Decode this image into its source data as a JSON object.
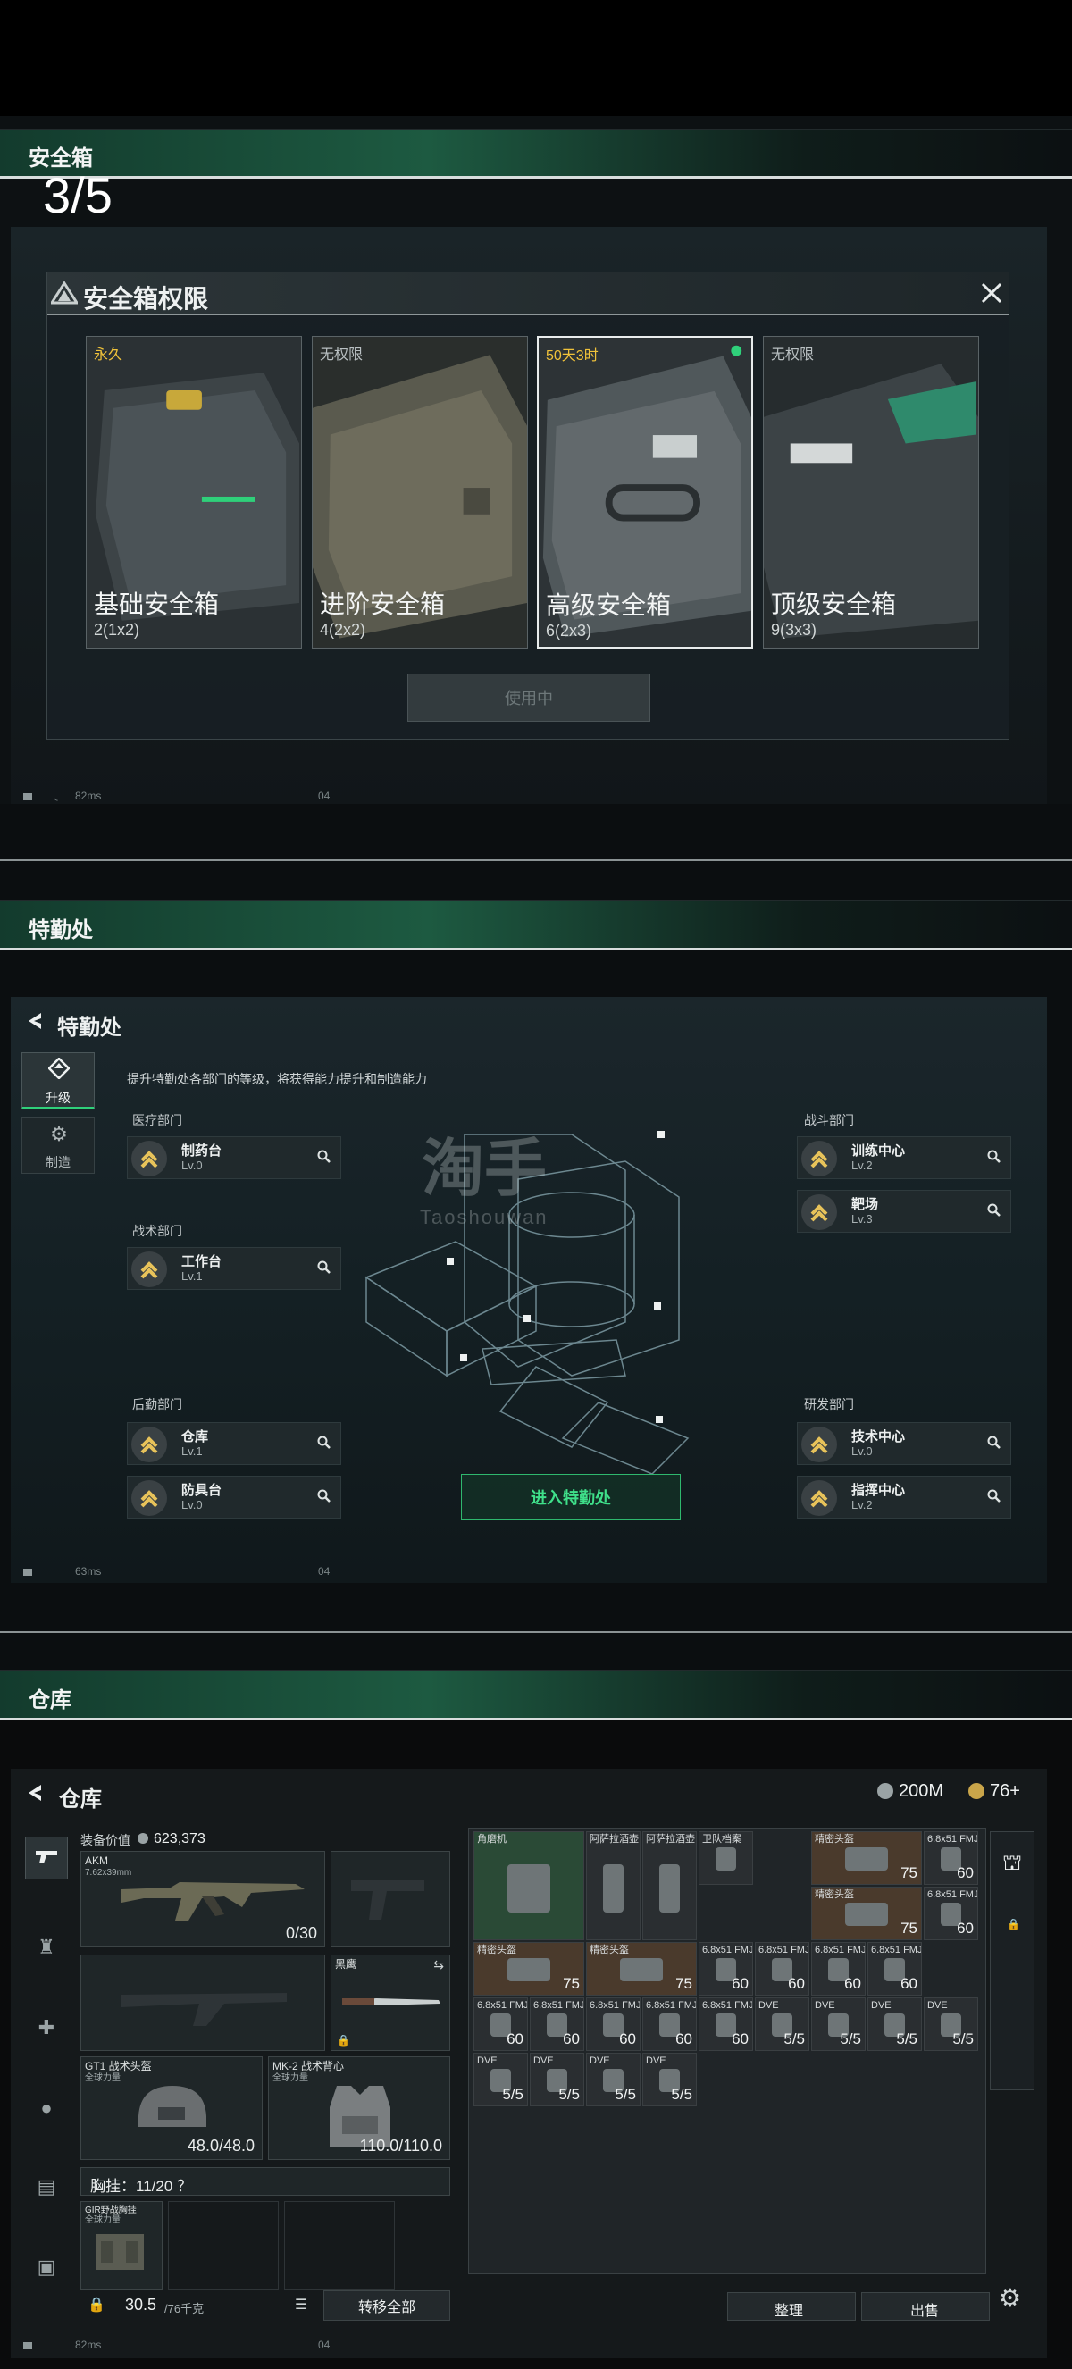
{
  "sections": {
    "safebox": "安全箱",
    "ops": "特勤处",
    "warehouse": "仓库"
  },
  "safebox": {
    "page_counter": "3/5",
    "dialog_title": "安全箱权限",
    "cards": [
      {
        "tag": "永久",
        "tag_color": "#f0c23a",
        "name": "基础安全箱",
        "capacity": "2(1x2)"
      },
      {
        "tag": "无权限",
        "tag_color": "#b9c0c2",
        "name": "进阶安全箱",
        "capacity": "4(2x2)"
      },
      {
        "tag": "50天3时",
        "tag_color": "#f0c23a",
        "name": "高级安全箱",
        "capacity": "6(2x3)"
      },
      {
        "tag": "无权限",
        "tag_color": "#b9c0c2",
        "name": "顶级安全箱",
        "capacity": "9(3x3)"
      }
    ],
    "use_button": "使用中",
    "status_ping": "82ms",
    "status_code": "04"
  },
  "ops": {
    "back_title": "特勤处",
    "tab_upgrade": "升级",
    "tab_craft": "制造",
    "description": "提升特勤处各部门的等级，将获得能力提升和制造能力",
    "watermark_cn": "淘手",
    "watermark_en": "Taoshouwan",
    "departments": {
      "medical": {
        "title": "医疗部门",
        "items": [
          {
            "name": "制药台",
            "level": "Lv.0"
          }
        ]
      },
      "tactical": {
        "title": "战术部门",
        "items": [
          {
            "name": "工作台",
            "level": "Lv.1"
          }
        ]
      },
      "logistics": {
        "title": "后勤部门",
        "items": [
          {
            "name": "仓库",
            "level": "Lv.1"
          },
          {
            "name": "防具台",
            "level": "Lv.0"
          }
        ]
      },
      "combat": {
        "title": "战斗部门",
        "items": [
          {
            "name": "训练中心",
            "level": "Lv.2"
          },
          {
            "name": "靶场",
            "level": "Lv.3"
          }
        ]
      },
      "research": {
        "title": "研发部门",
        "items": [
          {
            "name": "技术中心",
            "level": "Lv.0"
          },
          {
            "name": "指挥中心",
            "level": "Lv.2"
          }
        ]
      }
    },
    "enter_button": "进入特勤处",
    "status_ping": "63ms",
    "status_code": "04"
  },
  "warehouse": {
    "back_title": "仓库",
    "currency_1": "200M",
    "currency_2": "76+",
    "equip_value_label": "装备价值",
    "equip_value": "623,373",
    "primary_weapon": {
      "name": "AKM",
      "caliber": "7.62x39mm",
      "ammo": "0/30"
    },
    "melee_name": "黑鹰",
    "helmet": {
      "name": "GT1 战术头盔",
      "sub": "全球力量",
      "durability": "48.0/48.0"
    },
    "armor": {
      "name": "MK-2 战术背心",
      "sub": "全球力量",
      "durability": "110.0/110.0"
    },
    "chest_rig_label": "胸挂：11/20 ？",
    "chest_rig_item": "GIR野战胸挂",
    "chest_rig_sub": "全球力量",
    "weight": "30.5",
    "weight_max": "/76千克",
    "transfer_all": "转移全部",
    "sort_button": "整理",
    "sell_button": "出售",
    "status_ping": "82ms",
    "status_code": "04",
    "items": [
      {
        "name": "角磨机",
        "count": ""
      },
      {
        "name": "阿萨拉酒壶",
        "count": ""
      },
      {
        "name": "阿萨拉酒壶",
        "count": ""
      },
      {
        "name": "卫队档案",
        "count": ""
      },
      {
        "name": "精密头盔",
        "count": "75"
      },
      {
        "name": "精密头盔",
        "count": "75"
      },
      {
        "name": "精密头盔",
        "count": "75"
      },
      {
        "name": "精密头盔",
        "count": "75"
      },
      {
        "name": "6.8x51 FMJ",
        "count": "60"
      },
      {
        "name": "6.8x51 FMJ",
        "count": "60"
      },
      {
        "name": "6.8x51 FMJ",
        "count": "60"
      },
      {
        "name": "6.8x51 FMJ",
        "count": "60"
      },
      {
        "name": "6.8x51 FMJ",
        "count": "60"
      },
      {
        "name": "6.8x51 FMJ",
        "count": "60"
      },
      {
        "name": "6.8x51 FMJ",
        "count": "60"
      },
      {
        "name": "6.8x51 FMJ",
        "count": "60"
      },
      {
        "name": "6.8x51 FMJ",
        "count": "60"
      },
      {
        "name": "6.8x51 FMJ",
        "count": "60"
      },
      {
        "name": "6.8x51 FMJ",
        "count": "60"
      },
      {
        "name": "DVE",
        "count": "5/5"
      },
      {
        "name": "DVE",
        "count": "5/5"
      },
      {
        "name": "DVE",
        "count": "5/5"
      },
      {
        "name": "DVE",
        "count": "5/5"
      },
      {
        "name": "DVE",
        "count": "5/5"
      },
      {
        "name": "DVE",
        "count": "5/5"
      },
      {
        "name": "DVE",
        "count": "5/5"
      },
      {
        "name": "DVE",
        "count": "5/5"
      }
    ]
  }
}
